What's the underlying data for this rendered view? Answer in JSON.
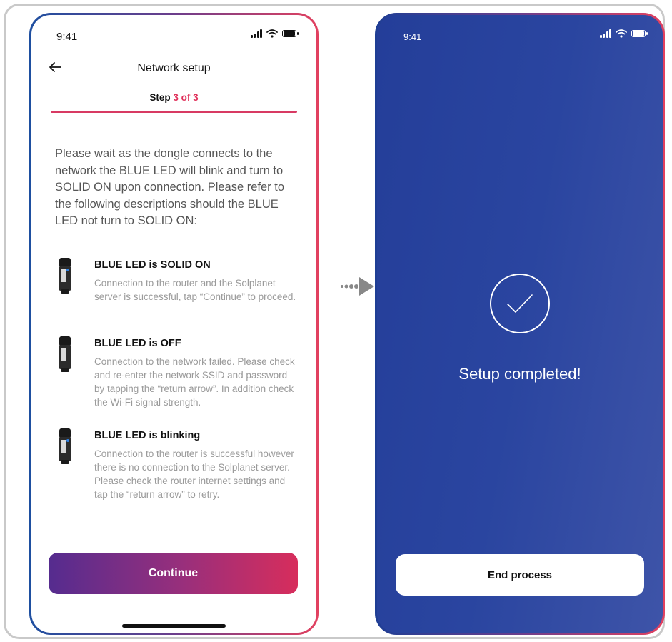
{
  "left_screen": {
    "status_time": "9:41",
    "header_title": "Network setup",
    "step_label": "Step",
    "step_value": "3 of 3",
    "intro_text": "Please wait as the dongle connects to the network the BLUE LED will blink and turn to SOLID ON upon connection. Please refer to the following descriptions should the BLUE LED not turn to SOLID ON:",
    "led_states": [
      {
        "title": "BLUE LED is SOLID ON",
        "description": "Connection to the router and the Solplanet server is successful, tap “Continue” to proceed.",
        "led_on": true
      },
      {
        "title": "BLUE LED is OFF",
        "description": "Connection to the network failed. Please check and re-enter the network SSID and password by tapping the “return arrow”. In addition check the Wi-Fi signal strength.",
        "led_on": false
      },
      {
        "title": "BLUE LED is blinking",
        "description": "Connection to the router is successful however there is no connection to the Solplanet server. Please check the router internet settings and tap the “return arrow” to retry.",
        "led_on": true
      }
    ],
    "continue_label": "Continue"
  },
  "right_screen": {
    "status_time": "9:41",
    "message": "Setup completed!",
    "end_label": "End process"
  },
  "colors": {
    "accent": "#e0305a",
    "brand_blue": "#2a45a0",
    "button_gradient_start": "#552c8f",
    "button_gradient_end": "#d72d5c",
    "led_blue": "#2f7fe0"
  }
}
